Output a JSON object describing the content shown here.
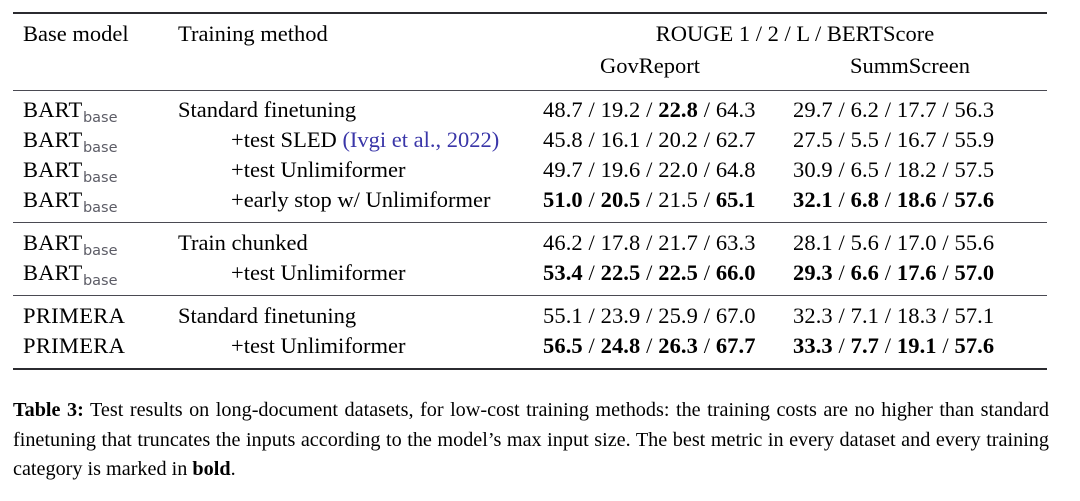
{
  "table": {
    "label": "Table 3",
    "columns": {
      "base_model": "Base model",
      "training_method": "Training method",
      "metric_header": "ROUGE 1 / 2 / L / BERTScore",
      "dataset_gov": "GovReport",
      "dataset_summ": "SummScreen"
    },
    "model_names": {
      "bart": "BART",
      "bart_sub": "base",
      "primera": "PRIMERA"
    },
    "blocks": [
      {
        "rows": [
          {
            "model": "BART",
            "model_sub": "base",
            "method": "Standard finetuning",
            "indent": false,
            "citation": "",
            "gov": [
              {
                "v": "48.7",
                "bold": false
              },
              {
                "v": "19.2",
                "bold": false
              },
              {
                "v": "22.8",
                "bold": true
              },
              {
                "v": "64.3",
                "bold": false
              }
            ],
            "summ": [
              {
                "v": "29.7",
                "bold": false
              },
              {
                "v": "6.2",
                "bold": false
              },
              {
                "v": "17.7",
                "bold": false
              },
              {
                "v": "56.3",
                "bold": false
              }
            ]
          },
          {
            "model": "BART",
            "model_sub": "base",
            "method": "+test SLED ",
            "indent": true,
            "citation": "(Ivgi et al., 2022)",
            "gov": [
              {
                "v": "45.8",
                "bold": false
              },
              {
                "v": "16.1",
                "bold": false
              },
              {
                "v": "20.2",
                "bold": false
              },
              {
                "v": "62.7",
                "bold": false
              }
            ],
            "summ": [
              {
                "v": "27.5",
                "bold": false
              },
              {
                "v": "5.5",
                "bold": false
              },
              {
                "v": "16.7",
                "bold": false
              },
              {
                "v": "55.9",
                "bold": false
              }
            ]
          },
          {
            "model": "BART",
            "model_sub": "base",
            "method": "+test Unlimiformer",
            "indent": true,
            "citation": "",
            "gov": [
              {
                "v": "49.7",
                "bold": false
              },
              {
                "v": "19.6",
                "bold": false
              },
              {
                "v": "22.0",
                "bold": false
              },
              {
                "v": "64.8",
                "bold": false
              }
            ],
            "summ": [
              {
                "v": "30.9",
                "bold": false
              },
              {
                "v": "6.5",
                "bold": false
              },
              {
                "v": "18.2",
                "bold": false
              },
              {
                "v": "57.5",
                "bold": false
              }
            ]
          },
          {
            "model": "BART",
            "model_sub": "base",
            "method": "+early stop w/ Unlimiformer",
            "indent": true,
            "citation": "",
            "gov": [
              {
                "v": "51.0",
                "bold": true
              },
              {
                "v": "20.5",
                "bold": true
              },
              {
                "v": "21.5",
                "bold": false
              },
              {
                "v": "65.1",
                "bold": true
              }
            ],
            "summ": [
              {
                "v": "32.1",
                "bold": true
              },
              {
                "v": "6.8",
                "bold": true
              },
              {
                "v": "18.6",
                "bold": true
              },
              {
                "v": "57.6",
                "bold": true
              }
            ]
          }
        ]
      },
      {
        "rows": [
          {
            "model": "BART",
            "model_sub": "base",
            "method": "Train chunked",
            "indent": false,
            "citation": "",
            "gov": [
              {
                "v": "46.2",
                "bold": false
              },
              {
                "v": "17.8",
                "bold": false
              },
              {
                "v": "21.7",
                "bold": false
              },
              {
                "v": "63.3",
                "bold": false
              }
            ],
            "summ": [
              {
                "v": "28.1",
                "bold": false
              },
              {
                "v": "5.6",
                "bold": false
              },
              {
                "v": "17.0",
                "bold": false
              },
              {
                "v": "55.6",
                "bold": false
              }
            ]
          },
          {
            "model": "BART",
            "model_sub": "base",
            "method": "+test Unlimiformer",
            "indent": true,
            "citation": "",
            "gov": [
              {
                "v": "53.4",
                "bold": true
              },
              {
                "v": "22.5",
                "bold": true
              },
              {
                "v": "22.5",
                "bold": true
              },
              {
                "v": "66.0",
                "bold": true
              }
            ],
            "summ": [
              {
                "v": "29.3",
                "bold": true
              },
              {
                "v": "6.6",
                "bold": true
              },
              {
                "v": "17.6",
                "bold": true
              },
              {
                "v": "57.0",
                "bold": true
              }
            ]
          }
        ]
      },
      {
        "rows": [
          {
            "model": "PRIMERA",
            "model_sub": "",
            "method": "Standard finetuning",
            "indent": false,
            "citation": "",
            "gov": [
              {
                "v": "55.1",
                "bold": false
              },
              {
                "v": "23.9",
                "bold": false
              },
              {
                "v": "25.9",
                "bold": false
              },
              {
                "v": "67.0",
                "bold": false
              }
            ],
            "summ": [
              {
                "v": "32.3",
                "bold": false
              },
              {
                "v": "7.1",
                "bold": false
              },
              {
                "v": "18.3",
                "bold": false
              },
              {
                "v": "57.1",
                "bold": false
              }
            ]
          },
          {
            "model": "PRIMERA",
            "model_sub": "",
            "method": "+test Unlimiformer",
            "indent": true,
            "citation": "",
            "gov": [
              {
                "v": "56.5",
                "bold": true
              },
              {
                "v": "24.8",
                "bold": true
              },
              {
                "v": "26.3",
                "bold": true
              },
              {
                "v": "67.7",
                "bold": true
              }
            ],
            "summ": [
              {
                "v": "33.3",
                "bold": true
              },
              {
                "v": "7.7",
                "bold": true
              },
              {
                "v": "19.1",
                "bold": true
              },
              {
                "v": "57.6",
                "bold": true
              }
            ]
          }
        ]
      }
    ]
  },
  "caption": {
    "label": "Table 3:",
    "part1": " Test results on long-document datasets, for low-cost training methods: the training costs are no higher than standard finetuning that truncates the inputs according to the model’s max input size. The best metric in every dataset and every training category is marked in ",
    "bold_word": "bold",
    "part2": "."
  },
  "colors": {
    "rule": "#2b2b30",
    "citation_link": "#3a36a8",
    "subscript": "#5c5c66",
    "text": "#000000"
  }
}
